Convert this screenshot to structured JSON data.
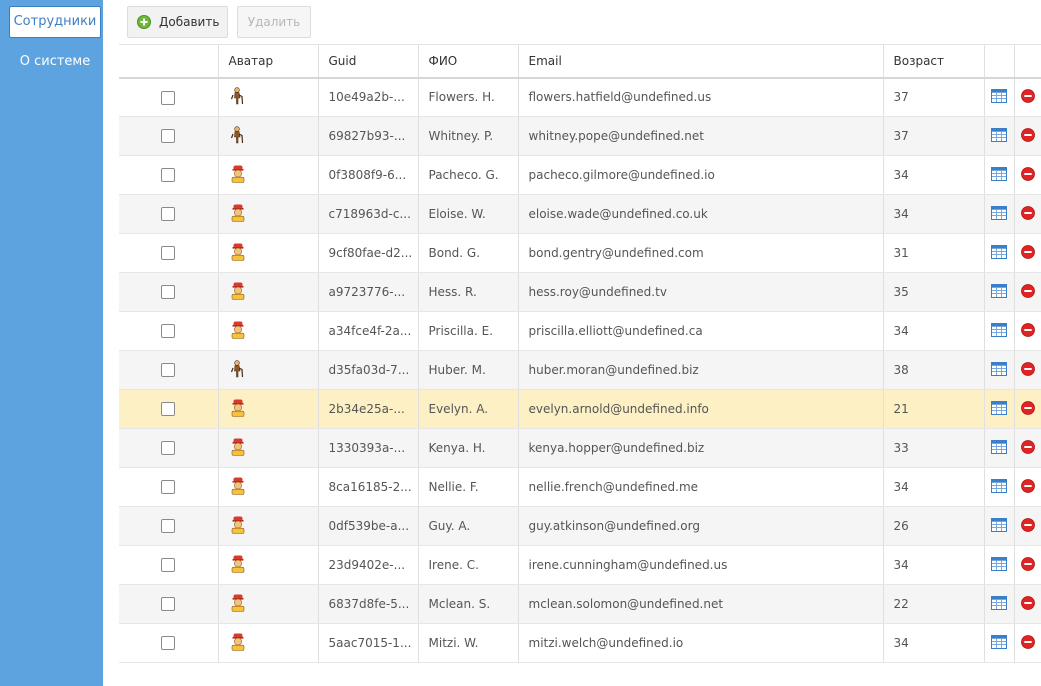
{
  "nav": {
    "items": [
      {
        "label": "Сотрудники",
        "active": true
      },
      {
        "label": "О системе",
        "active": false
      }
    ]
  },
  "toolbar": {
    "add_label": "Добавить",
    "delete_label": "Удалить",
    "delete_disabled": true
  },
  "table": {
    "columns": [
      "",
      "Аватар",
      "Guid",
      "ФИО",
      "Email",
      "Возраст",
      "",
      ""
    ],
    "selected_index": 8,
    "rows": [
      {
        "avatar": "elderly-person-icon",
        "guid": "10e49a2b-...",
        "name": "Flowers. H.",
        "email": "flowers.hatfield@undefined.us",
        "age": "37"
      },
      {
        "avatar": "elderly-person-icon",
        "guid": "69827b93-...",
        "name": "Whitney. P.",
        "email": "whitney.pope@undefined.net",
        "age": "37"
      },
      {
        "avatar": "person-icon",
        "guid": "0f3808f9-6...",
        "name": "Pacheco. G.",
        "email": "pacheco.gilmore@undefined.io",
        "age": "34"
      },
      {
        "avatar": "person-icon",
        "guid": "c718963d-c...",
        "name": "Eloise. W.",
        "email": "eloise.wade@undefined.co.uk",
        "age": "34"
      },
      {
        "avatar": "person-icon",
        "guid": "9cf80fae-d2...",
        "name": "Bond. G.",
        "email": "bond.gentry@undefined.com",
        "age": "31"
      },
      {
        "avatar": "person-icon",
        "guid": "a9723776-...",
        "name": "Hess. R.",
        "email": "hess.roy@undefined.tv",
        "age": "35"
      },
      {
        "avatar": "person-icon",
        "guid": "a34fce4f-2a...",
        "name": "Priscilla. E.",
        "email": "priscilla.elliott@undefined.ca",
        "age": "34"
      },
      {
        "avatar": "elderly-person-icon",
        "guid": "d35fa03d-7...",
        "name": "Huber. M.",
        "email": "huber.moran@undefined.biz",
        "age": "38"
      },
      {
        "avatar": "person-icon",
        "guid": "2b34e25a-...",
        "name": "Evelyn. A.",
        "email": "evelyn.arnold@undefined.info",
        "age": "21"
      },
      {
        "avatar": "person-icon",
        "guid": "1330393a-...",
        "name": "Kenya. H.",
        "email": "kenya.hopper@undefined.biz",
        "age": "33"
      },
      {
        "avatar": "person-icon",
        "guid": "8ca16185-2...",
        "name": "Nellie. F.",
        "email": "nellie.french@undefined.me",
        "age": "34"
      },
      {
        "avatar": "person-icon",
        "guid": "0df539be-a...",
        "name": "Guy. A.",
        "email": "guy.atkinson@undefined.org",
        "age": "26"
      },
      {
        "avatar": "person-icon",
        "guid": "23d9402e-...",
        "name": "Irene. C.",
        "email": "irene.cunningham@undefined.us",
        "age": "34"
      },
      {
        "avatar": "person-icon",
        "guid": "6837d8fe-5...",
        "name": "Mclean. S.",
        "email": "mclean.solomon@undefined.net",
        "age": "22"
      },
      {
        "avatar": "person-icon",
        "guid": "5aac7015-1...",
        "name": "Mitzi. W.",
        "email": "mitzi.welch@undefined.io",
        "age": "34"
      }
    ]
  },
  "colors": {
    "sidebar": "#5da3e0",
    "selected_row": "#fdf0c4",
    "alt_row": "#f5f5f5",
    "delete_icon": "#e02424",
    "edit_icon": "#3a7fc9"
  }
}
